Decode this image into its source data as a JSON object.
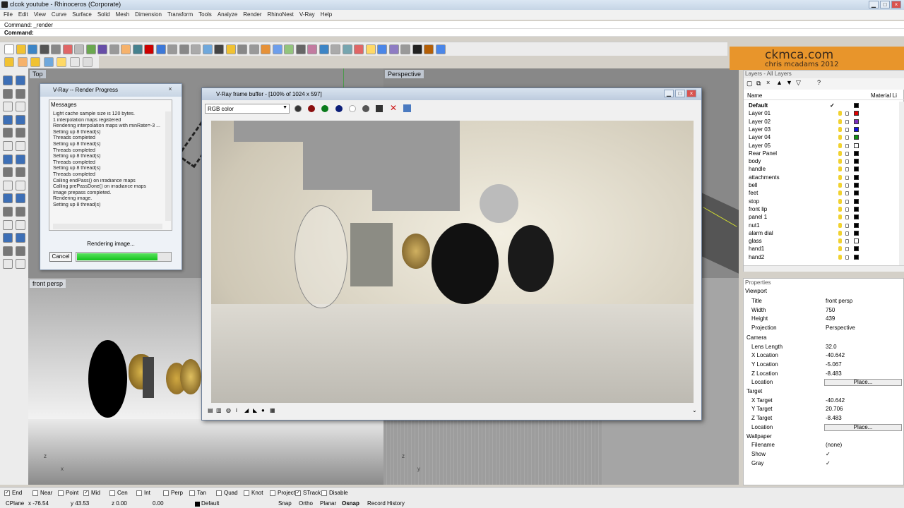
{
  "window": {
    "title": "clcok youtube - Rhinoceros (Corporate)"
  },
  "menu": [
    "File",
    "Edit",
    "View",
    "Curve",
    "Surface",
    "Solid",
    "Mesh",
    "Dimension",
    "Transform",
    "Tools",
    "Analyze",
    "Render",
    "RhinoNest",
    "V-Ray",
    "Help"
  ],
  "command": {
    "history": "Command: _render",
    "prompt": "Command:"
  },
  "viewports": {
    "top": "Top",
    "perspective": "Perspective",
    "front_persp": "front persp"
  },
  "logo": {
    "line1": "ckmca.com",
    "line2": "chris mcadams 2012"
  },
  "layers_panel": {
    "title": "Layers - All Layers",
    "col_name": "Name",
    "col_material": "Material Li",
    "rows": [
      {
        "name": "Default",
        "color": "#000000",
        "current": true
      },
      {
        "name": "Layer 01",
        "color": "#e00000"
      },
      {
        "name": "Layer 02",
        "color": "#7b2fbf"
      },
      {
        "name": "Layer 03",
        "color": "#1010e0"
      },
      {
        "name": "Layer 04",
        "color": "#109010"
      },
      {
        "name": "Layer 05",
        "color": "#ffffff"
      },
      {
        "name": "Rear Panel",
        "color": "#000000"
      },
      {
        "name": "body",
        "color": "#000000"
      },
      {
        "name": "handle",
        "color": "#000000"
      },
      {
        "name": "attachments",
        "color": "#000000"
      },
      {
        "name": "bell",
        "color": "#000000"
      },
      {
        "name": "feet",
        "color": "#000000"
      },
      {
        "name": "stop",
        "color": "#000000"
      },
      {
        "name": "front lip",
        "color": "#000000"
      },
      {
        "name": "panel 1",
        "color": "#000000"
      },
      {
        "name": "nut1",
        "color": "#000000"
      },
      {
        "name": "alarm dial",
        "color": "#000000"
      },
      {
        "name": "glass",
        "color": "#ffffff"
      },
      {
        "name": "hand1",
        "color": "#000000"
      },
      {
        "name": "hand2",
        "color": "#000000"
      }
    ],
    "current_mark": "✓"
  },
  "properties_panel": {
    "title": "Properties",
    "tab": "Viewport",
    "rows": [
      {
        "key": "Title",
        "value": "front persp"
      },
      {
        "key": "Width",
        "value": "750"
      },
      {
        "key": "Height",
        "value": "439"
      },
      {
        "key": "Projection",
        "value": "Perspective"
      }
    ],
    "camera_label": "Camera",
    "camera": [
      {
        "key": "Lens Length",
        "value": "32.0"
      },
      {
        "key": "X Location",
        "value": "-40.642"
      },
      {
        "key": "Y Location",
        "value": "-5.067"
      },
      {
        "key": "Z Location",
        "value": "-8.483"
      }
    ],
    "location_label": "Location",
    "place_label": "Place...",
    "target_label": "Target",
    "target": [
      {
        "key": "X Target",
        "value": "-40.642"
      },
      {
        "key": "Y Target",
        "value": "20.706"
      },
      {
        "key": "Z Target",
        "value": "-8.483"
      }
    ],
    "wallpaper_label": "Wallpaper",
    "wallpaper": [
      {
        "key": "Filename",
        "value": "(none)"
      },
      {
        "key": "Show",
        "value": "✓"
      },
      {
        "key": "Gray",
        "value": "✓"
      }
    ]
  },
  "render_progress": {
    "title": "V-Ray -- Render Progress",
    "messages_label": "Messages",
    "log": [
      "Light cache sample size is 120 bytes.",
      "1 interpolation maps registered",
      "Rendering interpolation maps with minRate=-3 ...",
      "Setting up 8 thread(s)",
      "Threads completed",
      "Setting up 8 thread(s)",
      "Threads completed",
      "Setting up 8 thread(s)",
      "Threads completed",
      "Setting up 8 thread(s)",
      "Threads completed",
      "Calling endPass() on irradiance maps",
      "Calling prePassDone() on irradiance maps",
      "Image prepass completed.",
      "Rendering image.",
      "Setting up 8 thread(s)"
    ],
    "status": "Rendering image...",
    "cancel": "Cancel",
    "progress": 0.85
  },
  "vfb": {
    "title": "V-Ray frame buffer - [100% of 1024 x 597]",
    "channel": "RGB color"
  },
  "osnaps": [
    {
      "label": "End",
      "checked": true
    },
    {
      "label": "Near",
      "checked": false
    },
    {
      "label": "Point",
      "checked": false
    },
    {
      "label": "Mid",
      "checked": true
    },
    {
      "label": "Cen",
      "checked": false
    },
    {
      "label": "Int",
      "checked": false
    },
    {
      "label": "Perp",
      "checked": false
    },
    {
      "label": "Tan",
      "checked": false
    },
    {
      "label": "Quad",
      "checked": false
    },
    {
      "label": "Knot",
      "checked": false
    },
    {
      "label": "Project",
      "checked": false
    },
    {
      "label": "STrack",
      "checked": true
    },
    {
      "label": "Disable",
      "checked": false
    }
  ],
  "status": {
    "cplane": "CPlane",
    "x": "x -76.54",
    "y": "y 43.53",
    "z": "z 0.00",
    "d": "0.00",
    "layer": "Default",
    "snap": "Snap",
    "ortho": "Ortho",
    "planar": "Planar",
    "osnap": "Osnap",
    "history": "Record History"
  },
  "axes": {
    "z": "z",
    "x": "x",
    "y": "y"
  }
}
